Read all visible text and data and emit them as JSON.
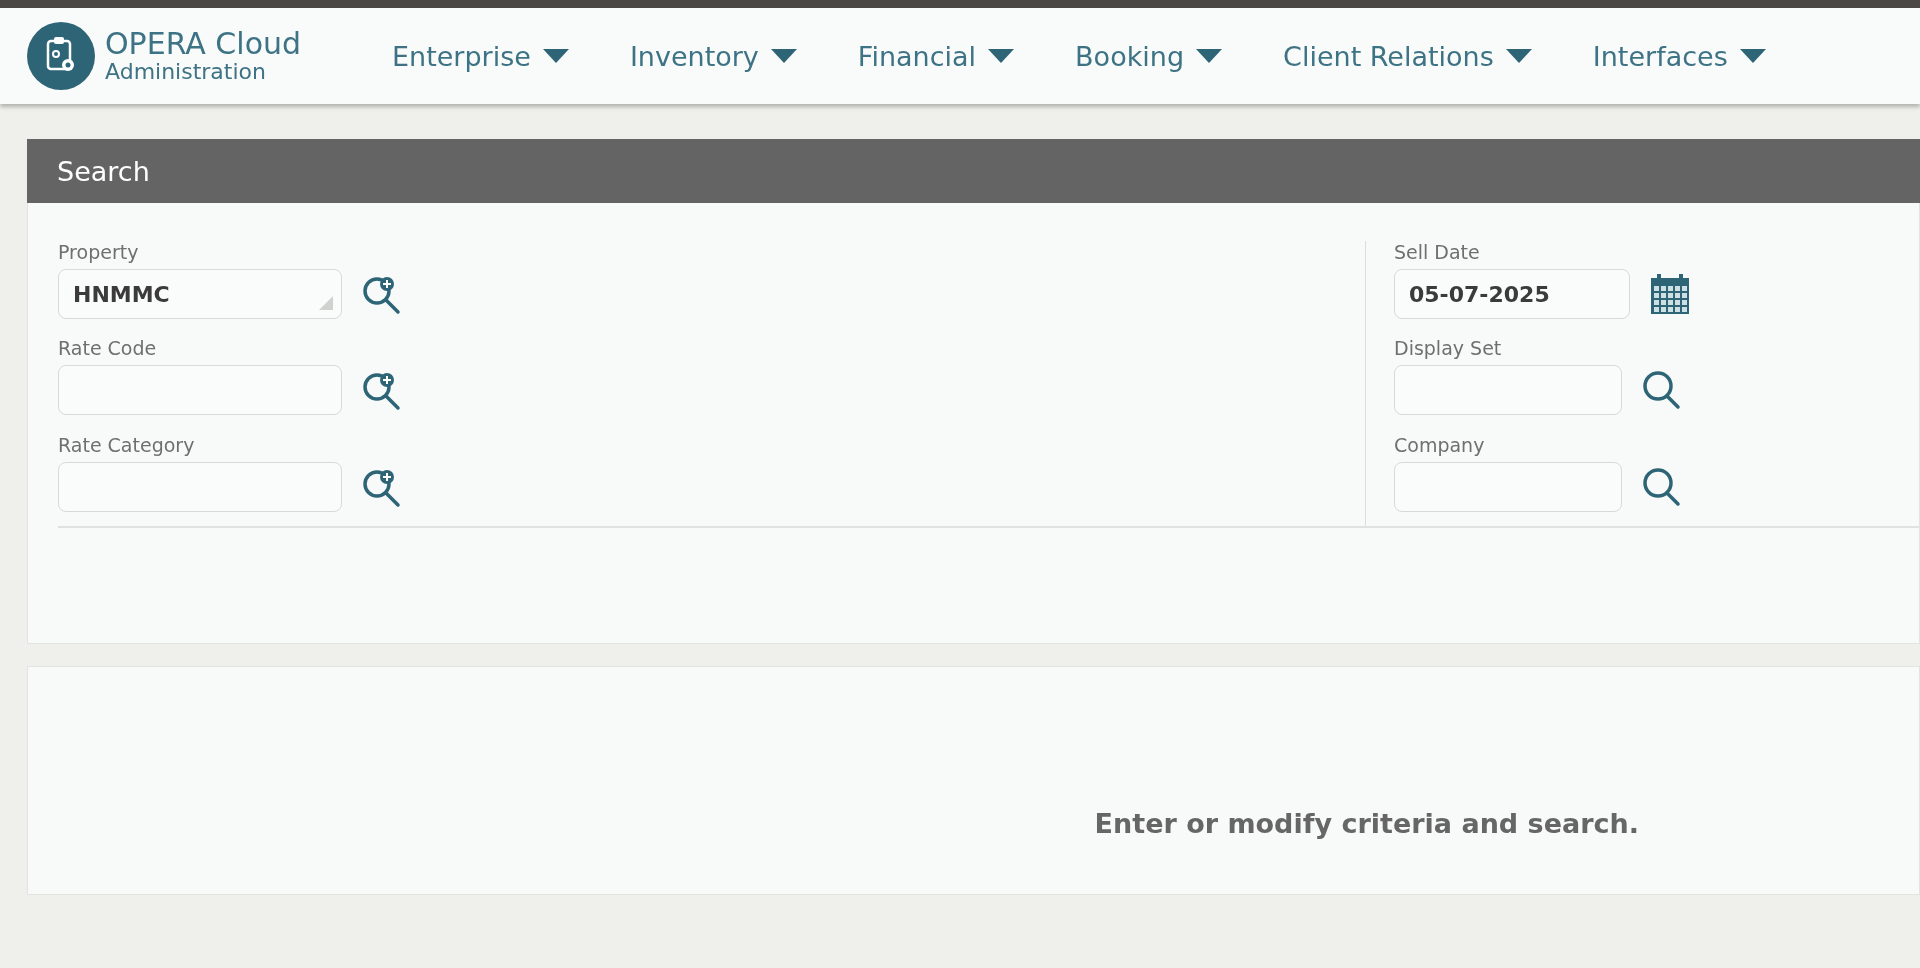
{
  "app": {
    "name": "OPERA Cloud",
    "module": "Administration"
  },
  "nav": [
    {
      "label": "Enterprise"
    },
    {
      "label": "Inventory"
    },
    {
      "label": "Financial"
    },
    {
      "label": "Booking"
    },
    {
      "label": "Client Relations"
    },
    {
      "label": "Interfaces"
    }
  ],
  "search_panel": {
    "title": "Search",
    "left_fields": [
      {
        "label": "Property",
        "value": "HNMMC",
        "kind": "lookup",
        "resizable": true
      },
      {
        "label": "Rate Code",
        "kind": "lookup"
      },
      {
        "label": "Rate Category",
        "kind": "lookup"
      }
    ],
    "right_fields": [
      {
        "label": "Sell Date",
        "value": "05-07-2025",
        "kind": "date"
      },
      {
        "label": "Display Set",
        "kind": "search"
      },
      {
        "label": "Company",
        "kind": "search"
      }
    ]
  },
  "results": {
    "message": "Enter or modify criteria and search."
  }
}
